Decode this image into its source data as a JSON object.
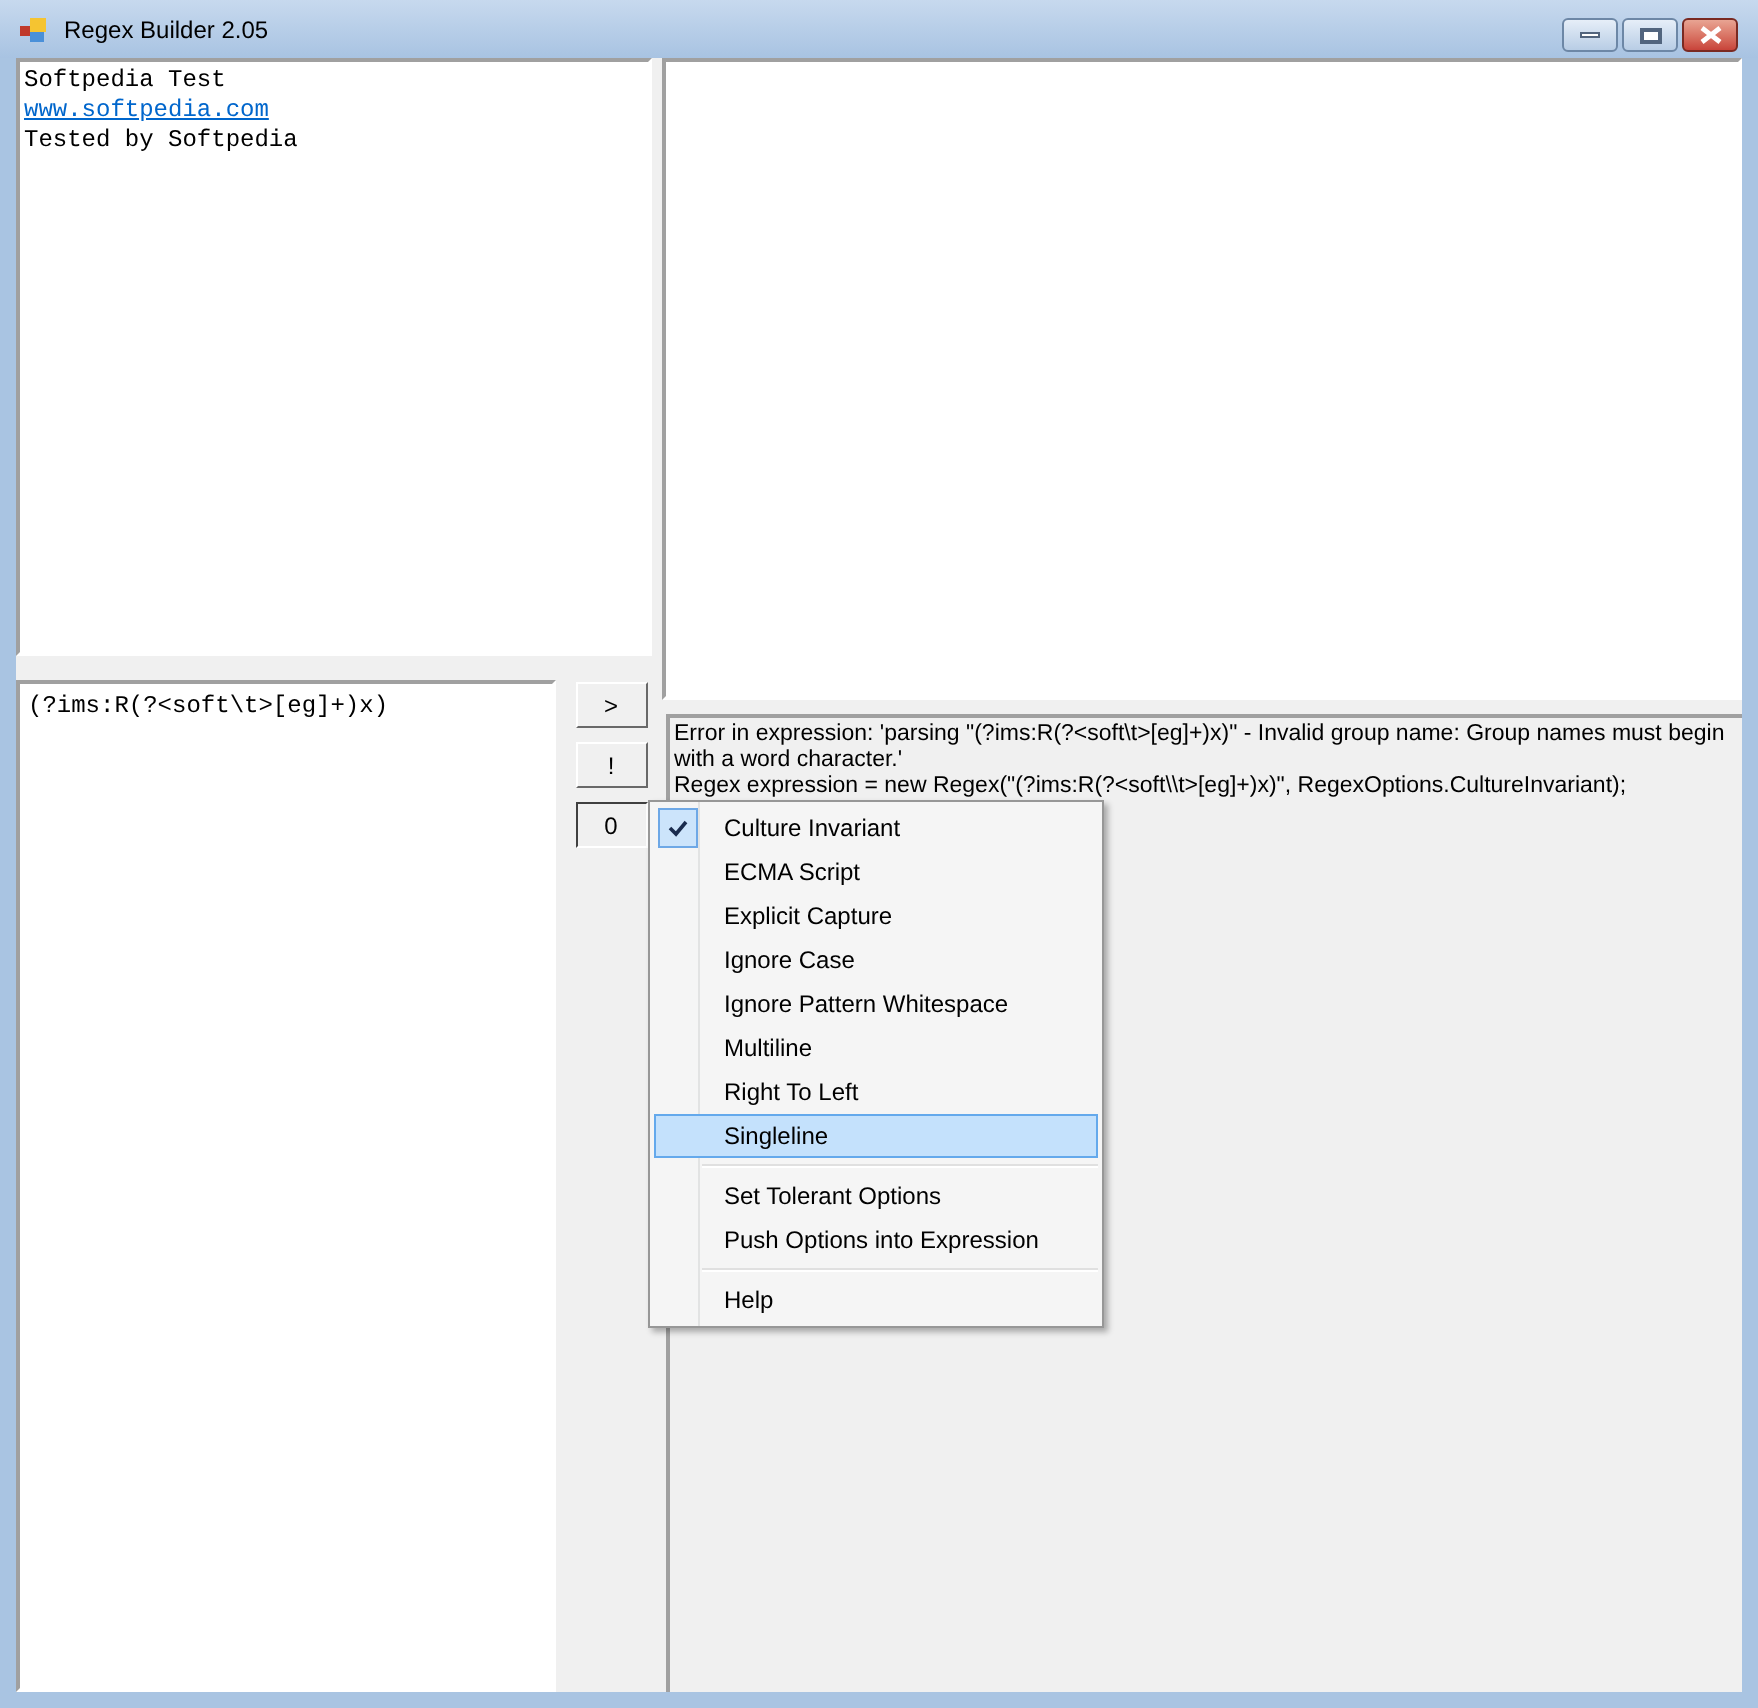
{
  "window": {
    "title": "Regex Builder 2.05"
  },
  "input_text": {
    "lines": [
      {
        "kind": "text",
        "text": "Softpedia Test"
      },
      {
        "kind": "link",
        "text": "www.softpedia.com"
      },
      {
        "kind": "text",
        "text": "Tested by Softpedia"
      }
    ]
  },
  "pattern": {
    "value": "(?ims:R(?<soft\\t>[eg]+)x)"
  },
  "buttons": [
    {
      "label": ">"
    },
    {
      "label": "!"
    },
    {
      "label": "0",
      "pressed": true
    }
  ],
  "output": {
    "lines": [
      "Error in expression: 'parsing \"(?ims:R(?<soft\\t>[eg]+)x)\" - Invalid group name: Group names must begin with a word character.'",
      "Regex expression = new Regex(\"(?ims:R(?<soft\\\\t>[eg]+)x)\", RegexOptions.CultureInvariant);"
    ]
  },
  "options_menu": {
    "items": [
      {
        "kind": "item",
        "label": "Culture Invariant",
        "checked": true,
        "selected": false
      },
      {
        "kind": "item",
        "label": "ECMA Script",
        "checked": false,
        "selected": false
      },
      {
        "kind": "item",
        "label": "Explicit Capture",
        "checked": false,
        "selected": false
      },
      {
        "kind": "item",
        "label": "Ignore Case",
        "checked": false,
        "selected": false
      },
      {
        "kind": "item",
        "label": "Ignore Pattern Whitespace",
        "checked": false,
        "selected": false
      },
      {
        "kind": "item",
        "label": "Multiline",
        "checked": false,
        "selected": false
      },
      {
        "kind": "item",
        "label": "Right To Left",
        "checked": false,
        "selected": false
      },
      {
        "kind": "item",
        "label": "Singleline",
        "checked": false,
        "selected": true
      },
      {
        "kind": "separator"
      },
      {
        "kind": "item",
        "label": "Set Tolerant Options",
        "checked": false,
        "selected": false
      },
      {
        "kind": "item",
        "label": "Push Options into Expression",
        "checked": false,
        "selected": false
      },
      {
        "kind": "separator"
      },
      {
        "kind": "item",
        "label": "Help",
        "checked": false,
        "selected": false
      }
    ]
  }
}
